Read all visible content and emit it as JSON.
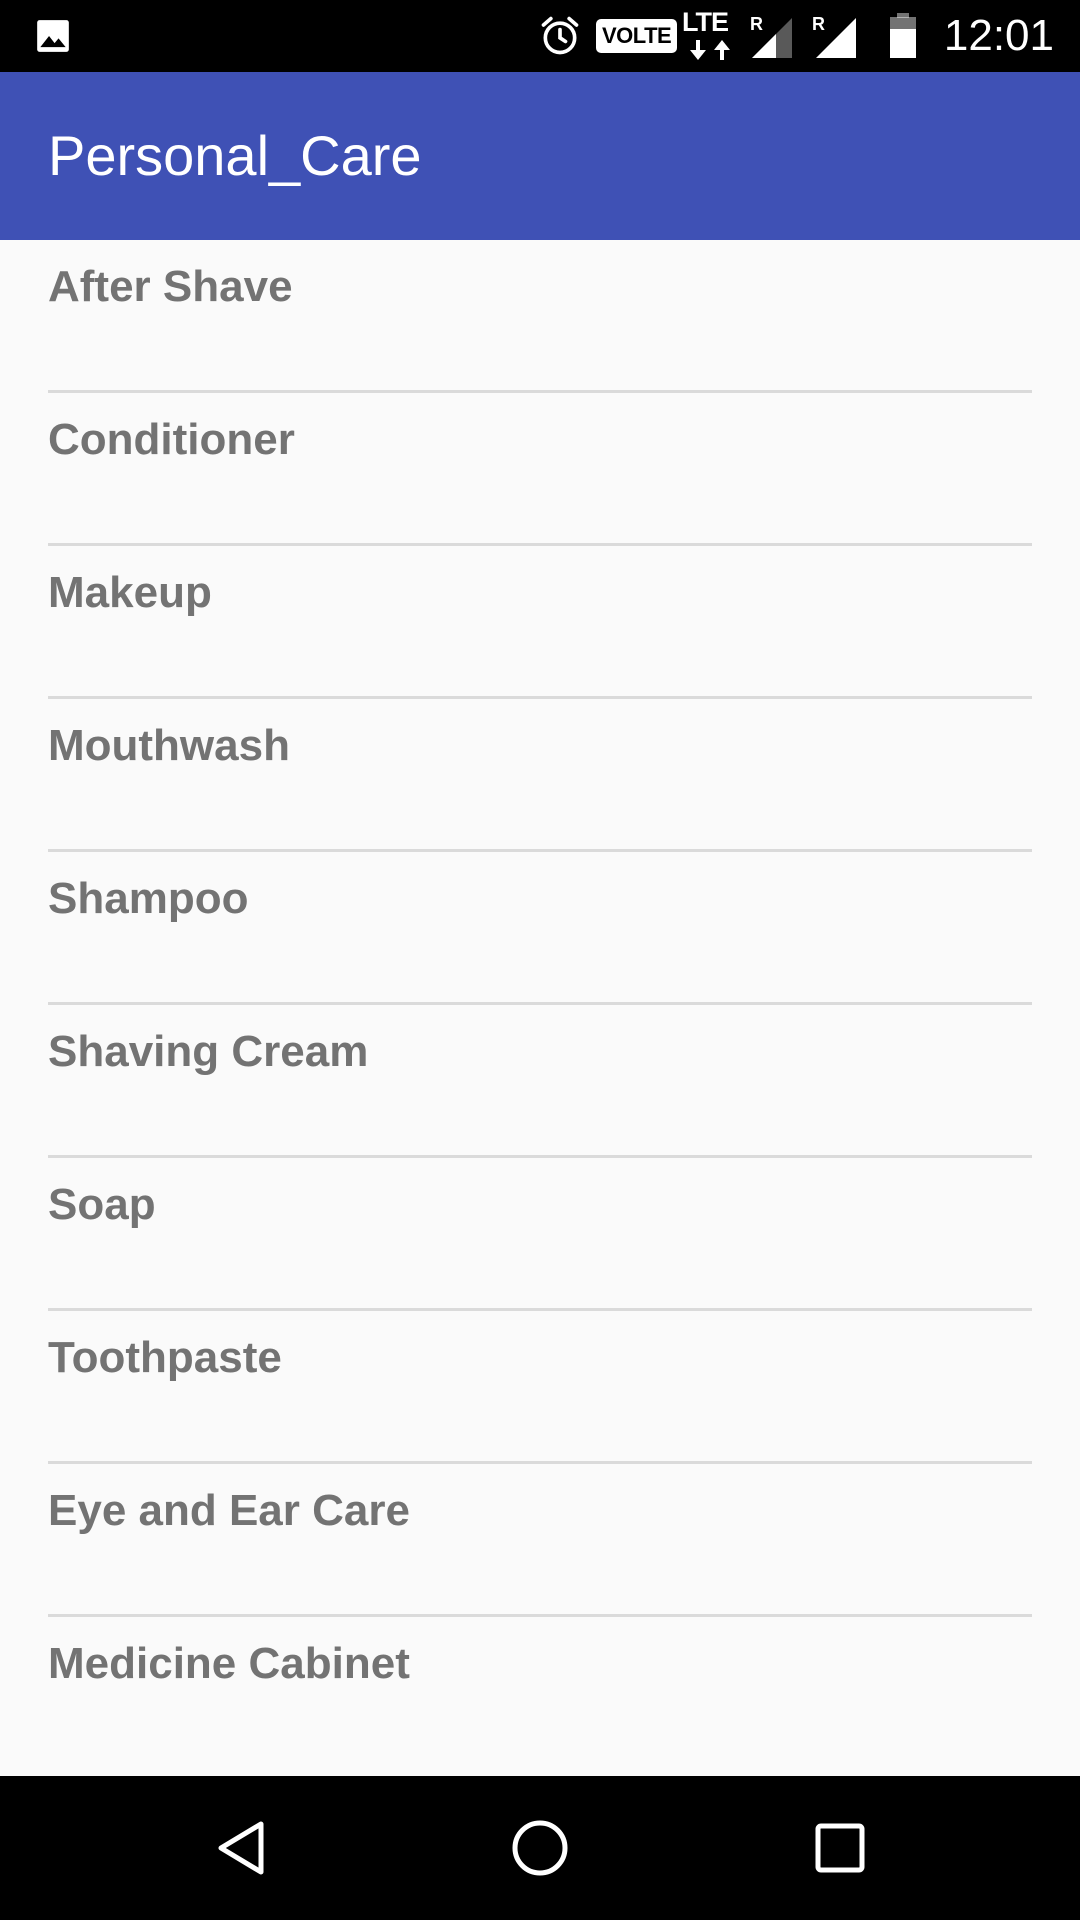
{
  "status_bar": {
    "time": "12:01",
    "volte_label": "VOLTE",
    "network_label": "LTE",
    "roaming_marks": [
      "R",
      "R"
    ],
    "icons": [
      "gallery-icon",
      "alarm-icon",
      "data-arrows-icon",
      "signal-icon",
      "signal-icon",
      "battery-icon"
    ]
  },
  "app_bar": {
    "title": "Personal_Care",
    "background_color": "#3F51B5"
  },
  "list": {
    "items": [
      {
        "label": "After Shave"
      },
      {
        "label": "Conditioner"
      },
      {
        "label": "Makeup"
      },
      {
        "label": "Mouthwash"
      },
      {
        "label": "Shampoo"
      },
      {
        "label": "Shaving Cream"
      },
      {
        "label": "Soap"
      },
      {
        "label": "Toothpaste"
      },
      {
        "label": "Eye and Ear Care"
      },
      {
        "label": "Medicine Cabinet"
      }
    ]
  },
  "nav_bar": {
    "icons": [
      "back-icon",
      "home-icon",
      "recents-icon"
    ]
  }
}
